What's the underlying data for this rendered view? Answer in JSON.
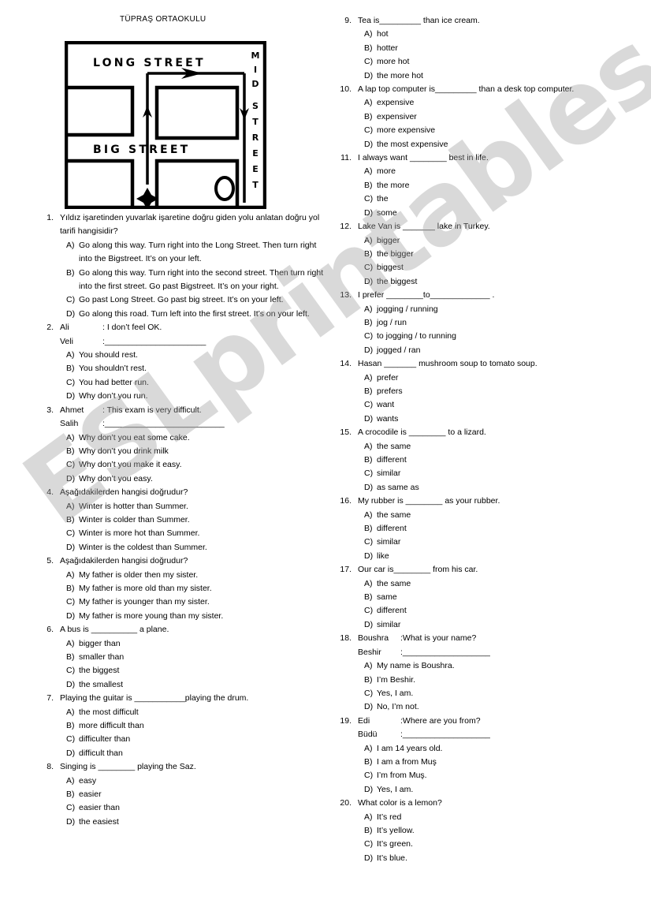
{
  "header": {
    "school_title": "TÜPRAŞ ORTAOKULU"
  },
  "watermark": {
    "text": "ESLprintables.com"
  },
  "map": {
    "long_street_label": "LONG STREET",
    "big_street_label": "BIG STREET",
    "mid_street_label": "MID STREET",
    "start_marker": "star",
    "end_marker": "circle"
  },
  "columns": {
    "left": [
      {
        "number": "1.",
        "stem": "Yıldız işaretinden yuvarlak işaretine doğru giden yolu anlatan doğru yol tarifi hangisidir?",
        "options": [
          {
            "letter": "A)",
            "text": "Go along this way. Turn right into the Long Street. Then turn right into the Bigstreet. It’s on your left."
          },
          {
            "letter": "B)",
            "text": "Go along this way. Turn right into the second street. Then turn right into the first street. Go past Bigstreet. It’s on your right."
          },
          {
            "letter": "C)",
            "text": "Go past Long Street. Go past big street. It’s on your left."
          },
          {
            "letter": "D)",
            "text": "Go along this road. Turn left into the first street. It’s on your left."
          }
        ]
      },
      {
        "number": "2.",
        "dialog": [
          {
            "speaker": "Ali",
            "said": ": I don’t feel OK."
          },
          {
            "speaker": "Veli",
            "said": ":______________________"
          }
        ],
        "options": [
          {
            "letter": "A)",
            "text": "You should rest."
          },
          {
            "letter": "B)",
            "text": "You shouldn’t rest."
          },
          {
            "letter": "C)",
            "text": "You had better run."
          },
          {
            "letter": "D)",
            "text": "Why don’t you run."
          }
        ]
      },
      {
        "number": "3.",
        "dialog": [
          {
            "speaker": "Ahmet",
            "said": ": This exam is very difficult."
          },
          {
            "speaker": "Salih",
            "said": ":__________________________"
          }
        ],
        "options": [
          {
            "letter": "A)",
            "text": "Why don’t you eat some cake."
          },
          {
            "letter": "B)",
            "text": "Why don’t you drink milk"
          },
          {
            "letter": "C)",
            "text": "Why don’t you make it easy."
          },
          {
            "letter": "D)",
            "text": "Why don’t you easy."
          }
        ]
      },
      {
        "number": "4.",
        "stem": "Aşağıdakilerden hangisi doğrudur?",
        "options": [
          {
            "letter": "A)",
            "text": "Winter is hotter than Summer."
          },
          {
            "letter": "B)",
            "text": "Winter is colder than Summer."
          },
          {
            "letter": "C)",
            "text": "Winter is more hot than Summer."
          },
          {
            "letter": "D)",
            "text": "Winter is the coldest than Summer."
          }
        ]
      },
      {
        "number": "5.",
        "stem": "Aşağıdakilerden hangisi doğrudur?",
        "options": [
          {
            "letter": "A)",
            "text": "My father is older then my sister."
          },
          {
            "letter": "B)",
            "text": "My father is more old than my sister."
          },
          {
            "letter": "C)",
            "text": "My father is younger than my sister."
          },
          {
            "letter": "D)",
            "text": "My father is more young than my sister."
          }
        ]
      },
      {
        "number": "6.",
        "stem": "A bus is __________ a plane.",
        "options": [
          {
            "letter": "A)",
            "text": "bigger than"
          },
          {
            "letter": "B)",
            "text": "smaller than"
          },
          {
            "letter": "C)",
            "text": "the biggest"
          },
          {
            "letter": "D)",
            "text": "the smallest"
          }
        ]
      },
      {
        "number": "7.",
        "stem": " Playing the guitar is ___________playing the drum.",
        "options": [
          {
            "letter": "A)",
            "text": "the most difficult"
          },
          {
            "letter": "B)",
            "text": "more difficult than"
          },
          {
            "letter": "C)",
            "text": "difficulter than"
          },
          {
            "letter": "D)",
            "text": "difficult than"
          }
        ]
      },
      {
        "number": "8.",
        "stem": "Singing is ________ playing the Saz.",
        "options": [
          {
            "letter": "A)",
            "text": "easy"
          },
          {
            "letter": "B)",
            "text": "easier"
          },
          {
            "letter": "C)",
            "text": "easier than"
          },
          {
            "letter": "D)",
            "text": "the easiest"
          }
        ]
      }
    ],
    "right": [
      {
        "number": "9.",
        "stem": "Tea is_________ than ice cream.",
        "options": [
          {
            "letter": "A)",
            "text": "hot"
          },
          {
            "letter": "B)",
            "text": "hotter"
          },
          {
            "letter": "C)",
            "text": "more hot"
          },
          {
            "letter": "D)",
            "text": "the more hot"
          }
        ]
      },
      {
        "number": "10.",
        "stem": " A lap top computer is_________ than a desk top computer.",
        "options": [
          {
            "letter": "A)",
            "text": "expensive"
          },
          {
            "letter": "B)",
            "text": "expensiver"
          },
          {
            "letter": "C)",
            "text": "more expensive"
          },
          {
            "letter": "D)",
            "text": "the most expensive"
          }
        ]
      },
      {
        "number": "11.",
        "stem": "I always want ________ best in life.",
        "options": [
          {
            "letter": "A)",
            "text": "more"
          },
          {
            "letter": "B)",
            "text": "the more"
          },
          {
            "letter": "C)",
            "text": "the"
          },
          {
            "letter": "D)",
            "text": "some"
          }
        ]
      },
      {
        "number": "12.",
        "stem": "Lake Van is _______ lake in Turkey.",
        "options": [
          {
            "letter": "A)",
            "text": "bigger"
          },
          {
            "letter": "B)",
            "text": "the bigger"
          },
          {
            "letter": "C)",
            "text": "biggest"
          },
          {
            "letter": "D)",
            "text": "the biggest"
          }
        ]
      },
      {
        "number": "13.",
        "stem": "I prefer ________to_____________ .",
        "options": [
          {
            "letter": "A)",
            "text": "jogging / running"
          },
          {
            "letter": "B)",
            "text": "jog / run"
          },
          {
            "letter": "C)",
            "text": "to jogging / to running"
          },
          {
            "letter": "D)",
            "text": "jogged / ran"
          }
        ]
      },
      {
        "number": "14.",
        "stem": "Hasan _______ mushroom soup to tomato soup.",
        "options": [
          {
            "letter": "A)",
            "text": "prefer"
          },
          {
            "letter": "B)",
            "text": "prefers"
          },
          {
            "letter": "C)",
            "text": "want"
          },
          {
            "letter": "D)",
            "text": "wants"
          }
        ]
      },
      {
        "number": "15.",
        "stem": "A crocodile is ________ to a lizard.",
        "options": [
          {
            "letter": "A)",
            "text": "the same"
          },
          {
            "letter": "B)",
            "text": "different"
          },
          {
            "letter": "C)",
            "text": "similar"
          },
          {
            "letter": "D)",
            "text": "as same as"
          }
        ]
      },
      {
        "number": "16.",
        "stem": "My rubber is ________ as your rubber.",
        "options": [
          {
            "letter": "A)",
            "text": "the same"
          },
          {
            "letter": "B)",
            "text": "different"
          },
          {
            "letter": "C)",
            "text": "similar"
          },
          {
            "letter": "D)",
            "text": "like"
          }
        ]
      },
      {
        "number": "17.",
        "stem": "Our car is________ from his car.",
        "options": [
          {
            "letter": "A)",
            "text": "the same"
          },
          {
            "letter": "B)",
            "text": "same"
          },
          {
            "letter": "C)",
            "text": "different"
          },
          {
            "letter": "D)",
            "text": "similar"
          }
        ]
      },
      {
        "number": "18.",
        "dialog": [
          {
            "speaker": "Boushra",
            "said": ":What is your name?"
          },
          {
            "speaker": "Beshir",
            "said": ":___________________"
          }
        ],
        "options": [
          {
            "letter": "A)",
            "text": "My name is Boushra."
          },
          {
            "letter": "B)",
            "text": "I’m Beshir."
          },
          {
            "letter": "C)",
            "text": "Yes, I am."
          },
          {
            "letter": "D)",
            "text": "No, I’m not."
          }
        ]
      },
      {
        "number": "19.",
        "dialog": [
          {
            "speaker": "Edi",
            "said": ":Where are you from?"
          },
          {
            "speaker": "Büdü",
            "said": ":___________________"
          }
        ],
        "options": [
          {
            "letter": "A)",
            "text": "I am 14 years old."
          },
          {
            "letter": "B)",
            "text": "I am a from Muş"
          },
          {
            "letter": "C)",
            "text": "I’m from Muş."
          },
          {
            "letter": "D)",
            "text": "Yes, I am."
          }
        ]
      },
      {
        "number": "20.",
        "stem": "What color is a lemon?",
        "options": [
          {
            "letter": "A)",
            "text": "It’s red"
          },
          {
            "letter": "B)",
            "text": "It’s yellow."
          },
          {
            "letter": "C)",
            "text": "It’s green."
          },
          {
            "letter": "D)",
            "text": "It’s blue."
          }
        ]
      }
    ]
  }
}
